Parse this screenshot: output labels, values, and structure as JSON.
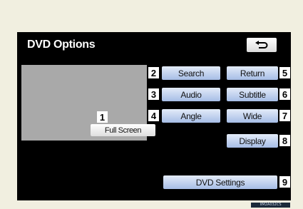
{
  "screen": {
    "title": "DVD Options",
    "back_icon": "return-arrow-icon"
  },
  "buttons": {
    "search": "Search",
    "audio": "Audio",
    "angle": "Angle",
    "return": "Return",
    "subtitle": "Subtitle",
    "wide": "Wide",
    "display": "Display",
    "dvd_settings": "DVD Settings",
    "full_screen": "Full Screen"
  },
  "callouts": {
    "n1": "1",
    "n2": "2",
    "n3": "3",
    "n4": "4",
    "n5": "5",
    "n6": "6",
    "n7": "7",
    "n8": "8",
    "n9": "9"
  },
  "image_code": "IIM2A032CS"
}
